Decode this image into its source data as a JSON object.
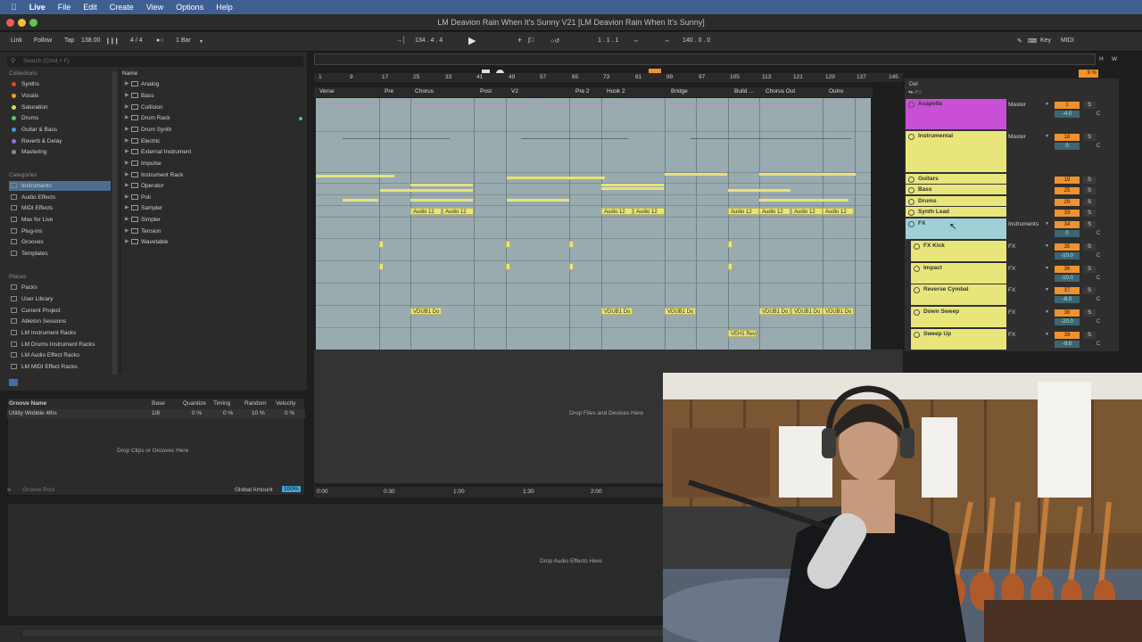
{
  "menubar": {
    "app": "Live",
    "items": [
      "File",
      "Edit",
      "Create",
      "View",
      "Options",
      "Help"
    ]
  },
  "window": {
    "title": "LM Deavion Rain When It's Sunny V21  [LM Deavion Rain When It's Sunny]"
  },
  "control": {
    "link": "Link",
    "follow": "Follow",
    "tap": "Tap",
    "tempo": "138.00",
    "signature": "4 / 4",
    "quantize": "1 Bar",
    "position": "134 .  4 .  4",
    "loop_start": "1 .  1 .  1",
    "loop_len": "140 .  0 .  0",
    "key": "Key",
    "midi": "MIDI",
    "cpu": "9 %"
  },
  "browser": {
    "search_placeholder": "Search (Cmd + F)",
    "collections_header": "Collections",
    "collections": [
      {
        "label": "Synths",
        "color": "#e0452f"
      },
      {
        "label": "Vocals",
        "color": "#f09a2e"
      },
      {
        "label": "Saturation",
        "color": "#e6d44b"
      },
      {
        "label": "Drums",
        "color": "#57c46b"
      },
      {
        "label": "Guitar & Bass",
        "color": "#3a9fd8"
      },
      {
        "label": "Reverb & Delay",
        "color": "#9a6fd8"
      },
      {
        "label": "Mastering",
        "color": "#8a8a8a"
      }
    ],
    "categories_header": "Categories",
    "categories": [
      "Instruments",
      "Audio Effects",
      "MIDI Effects",
      "Max for Live",
      "Plug-ins",
      "Grooves",
      "Templates"
    ],
    "places_header": "Places",
    "places": [
      "Packs",
      "User Library",
      "Current Project",
      "Ableton Sessions",
      "LM Instrument Racks",
      "LM Drums Instrument Racks",
      "LM Audio Effect Racks",
      "LM MIDI Effect Racks"
    ],
    "name_header": "Name",
    "names": [
      "Analog",
      "Bass",
      "Collision",
      "Drum Rack",
      "Drum Synth",
      "Electric",
      "External Instrument",
      "Impulse",
      "Instrument Rack",
      "Operator",
      "Poli",
      "Sampler",
      "Simpler",
      "Tension",
      "Wavetable"
    ]
  },
  "groove": {
    "headers": [
      "Groove Name",
      "Base",
      "Quantize",
      "Timing",
      "Random",
      "Velocity"
    ],
    "row": {
      "name": "Utility Wobble 4ths",
      "base": "1/8",
      "quantize": "0 %",
      "timing": "0 %",
      "random": "10 %",
      "velocity": "0 %"
    },
    "drop_text": "Drop Clips or Grooves Here",
    "pool_label": "Groove Pool",
    "global_label": "Global Amount",
    "global_value": "100%"
  },
  "arrangement": {
    "bar_numbers": [
      "1",
      "9",
      "17",
      "25",
      "33",
      "41",
      "49",
      "57",
      "65",
      "73",
      "81",
      "89",
      "97",
      "105",
      "113",
      "121",
      "129",
      "137",
      "145"
    ],
    "locators": [
      "Verse",
      "Pre",
      "Chorus",
      "Post",
      "V2",
      "Pre 2",
      "Hook 2",
      "Bridge",
      "Build ...",
      "Chorus Out",
      "Outro"
    ],
    "clip_audio": "Audio 12",
    "clip_vdub": "VDUB1 Do",
    "clip_veh": "VEH1 Rev",
    "drop_files": "Drop Files and Devices Here",
    "times": [
      "0:00",
      "0:30",
      "1:00",
      "1:30",
      "2:00"
    ]
  },
  "mixer": {
    "header": "Del",
    "tracks": [
      {
        "name": "Acapella",
        "out": "Master",
        "num": "1",
        "vol": "-4.0",
        "color": "#c84fd6"
      },
      {
        "name": "Instrumental",
        "out": "Master",
        "num": "18",
        "vol": "0",
        "color": "#e8e67b"
      },
      {
        "name": "Guitars",
        "out": "",
        "num": "19",
        "vol": "",
        "color": "#e8e67b"
      },
      {
        "name": "Bass",
        "out": "",
        "num": "25",
        "vol": "",
        "color": "#e8e67b"
      },
      {
        "name": "Drums",
        "out": "",
        "num": "29",
        "vol": "",
        "color": "#e8e67b"
      },
      {
        "name": "Synth Lead",
        "out": "",
        "num": "33",
        "vol": "",
        "color": "#e8e67b"
      },
      {
        "name": "FX",
        "out": "Instruments",
        "num": "34",
        "vol": "0",
        "color": "#9fd0d8"
      },
      {
        "name": "FX Kick",
        "out": "FX",
        "num": "35",
        "vol": "-10.0",
        "color": "#e8e67b"
      },
      {
        "name": "Impact",
        "out": "FX",
        "num": "36",
        "vol": "-10.0",
        "color": "#e8e67b"
      },
      {
        "name": "Reverse Cymbal",
        "out": "FX",
        "num": "37",
        "vol": "-8.0",
        "color": "#e8e67b"
      },
      {
        "name": "Down Sweep",
        "out": "FX",
        "num": "38",
        "vol": "-20.0",
        "color": "#e8e67b"
      },
      {
        "name": "Sweep Up",
        "out": "FX",
        "num": "39",
        "vol": "-9.0",
        "color": "#e8e67b"
      }
    ],
    "solo": "S",
    "center": "C"
  },
  "detail": {
    "drop_text": "Drop Audio Effects Here"
  },
  "webcam": {}
}
